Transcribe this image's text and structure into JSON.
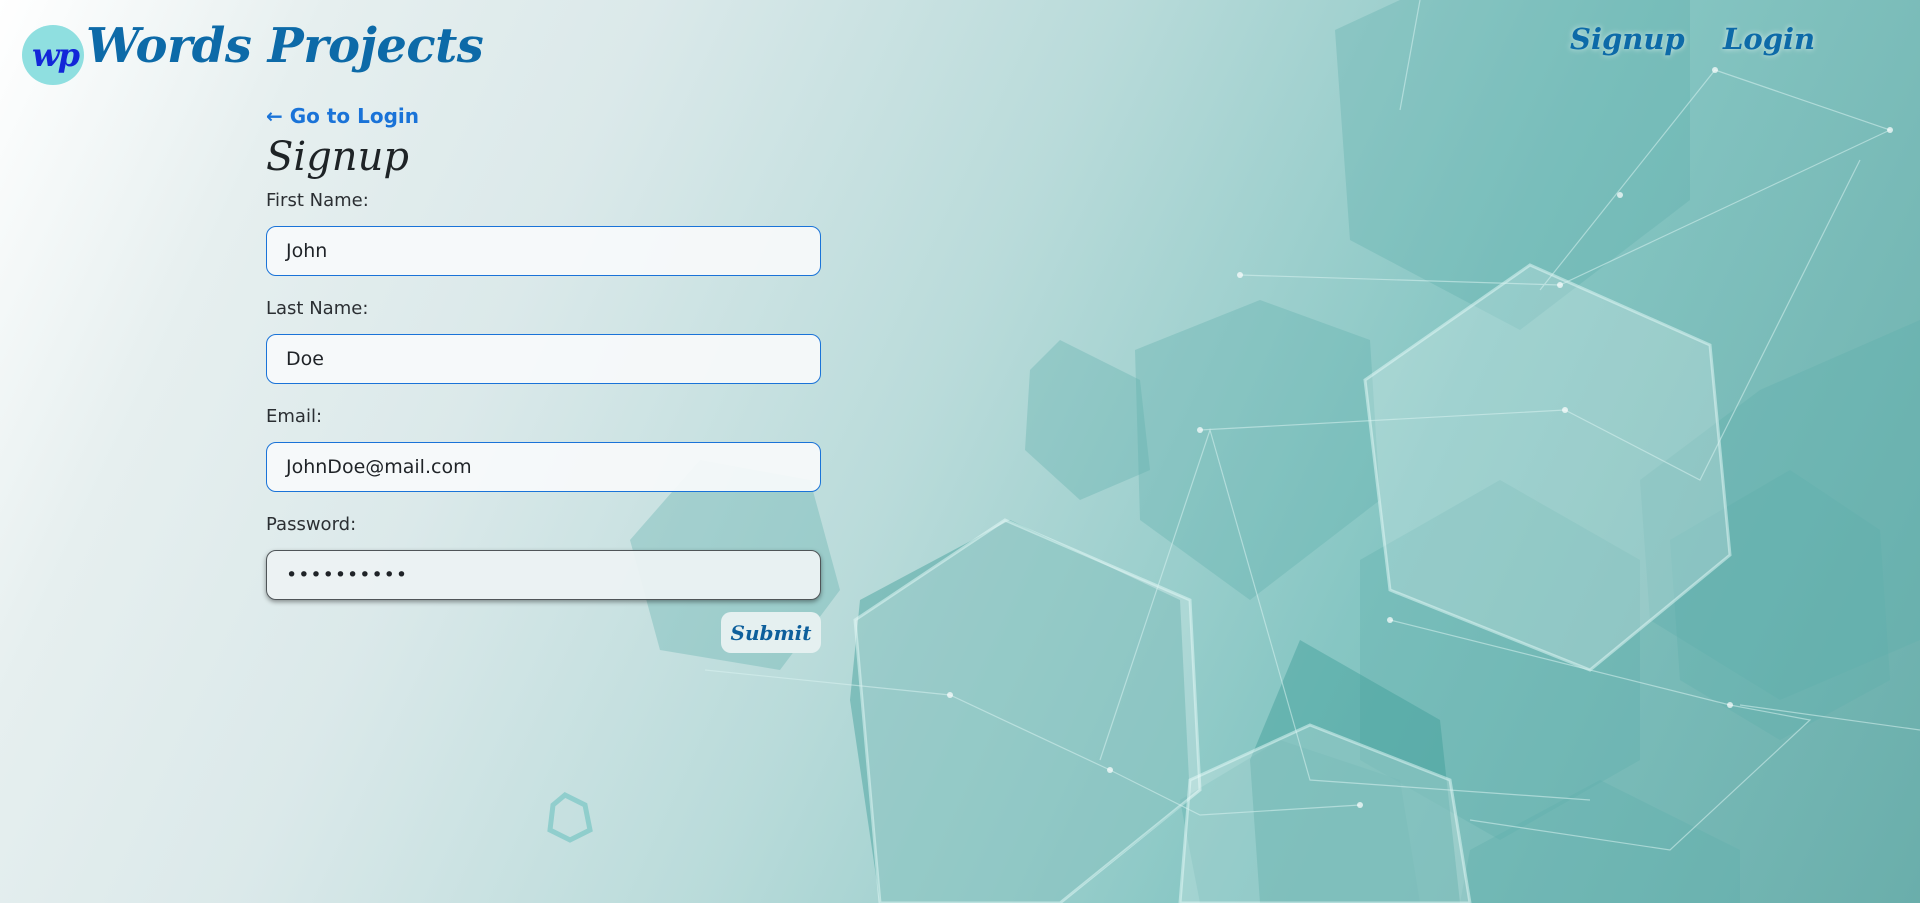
{
  "header": {
    "logo_text": "wp",
    "brand": "Words Projects",
    "nav": [
      {
        "label": "Signup"
      },
      {
        "label": "Login"
      }
    ]
  },
  "form": {
    "back_link": "← Go to Login",
    "title": "Signup",
    "fields": [
      {
        "label": "First Name:",
        "value": "John"
      },
      {
        "label": "Last Name:",
        "value": "Doe"
      },
      {
        "label": "Email:",
        "value": "JohnDoe@mail.com"
      },
      {
        "label": "Password:",
        "value": "••••••••••"
      }
    ],
    "submit_label": "Submit"
  },
  "colors": {
    "brand": "#0d6aa8",
    "link": "#1a73d8",
    "logo_bg": "#8fdfe0",
    "logo_text": "#1226d8"
  }
}
